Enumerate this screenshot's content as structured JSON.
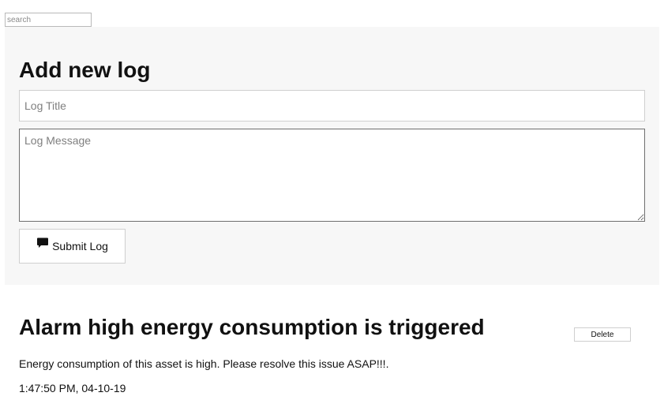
{
  "search": {
    "placeholder": "search",
    "value": ""
  },
  "form": {
    "heading": "Add new log",
    "title_placeholder": "Log Title",
    "message_placeholder": "Log Message",
    "submit_label": "Submit Log",
    "submit_icon": "comment-icon"
  },
  "logs": [
    {
      "title": "Alarm high energy consumption is triggered",
      "message": "Energy consumption of this asset is high. Please resolve this issue ASAP!!!.",
      "timestamp": "1:47:50 PM, 04-10-19",
      "delete_label": "Delete"
    }
  ]
}
